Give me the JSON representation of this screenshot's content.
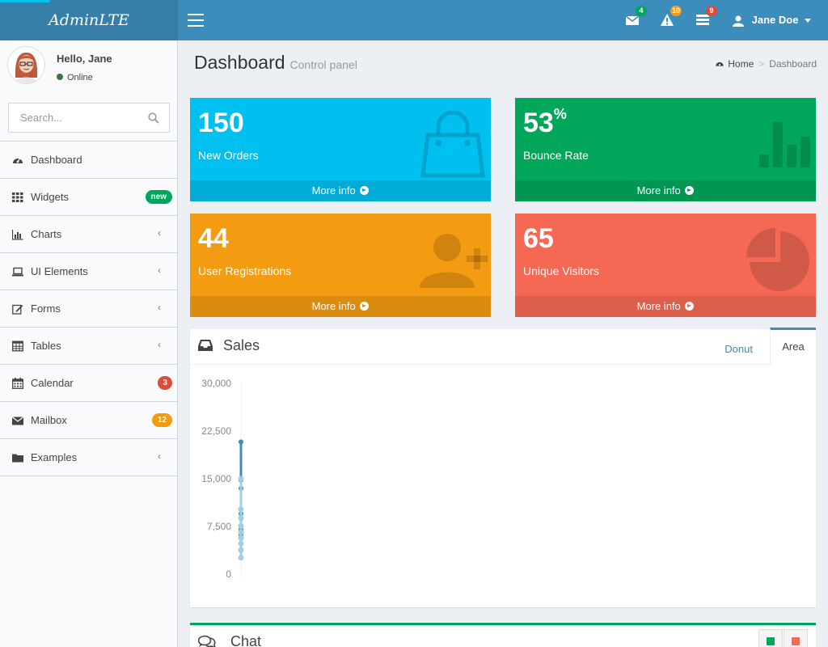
{
  "app": {
    "logo": "AdminLTE",
    "accent": "#3c8dbc"
  },
  "navbar": {
    "messages": {
      "icon": "envelope-icon",
      "count": "4",
      "color": "#00a65a"
    },
    "notifications": {
      "icon": "warning-icon",
      "count": "10",
      "color": "#f39c12"
    },
    "tasks": {
      "icon": "tasks-icon",
      "count": "9",
      "color": "#dd4b39"
    },
    "user": {
      "name": "Jane Doe",
      "icon": "user-icon"
    }
  },
  "sidebar": {
    "greeting": "Hello, Jane",
    "status": "Online",
    "search": {
      "placeholder": "Search...",
      "value": ""
    },
    "items": [
      {
        "label": "Dashboard",
        "icon": "dashboard-icon"
      },
      {
        "label": "Widgets",
        "icon": "th-icon",
        "badge": "new",
        "badge_color": "#00a65a"
      },
      {
        "label": "Charts",
        "icon": "bar-chart-icon",
        "chevron": "‹"
      },
      {
        "label": "UI Elements",
        "icon": "laptop-icon",
        "chevron": "‹"
      },
      {
        "label": "Forms",
        "icon": "edit-icon",
        "chevron": "‹"
      },
      {
        "label": "Tables",
        "icon": "table-icon",
        "chevron": "‹"
      },
      {
        "label": "Calendar",
        "icon": "calendar-icon",
        "badge": "3",
        "badge_color": "#dd4b39"
      },
      {
        "label": "Mailbox",
        "icon": "envelope-icon",
        "badge": "12",
        "badge_color": "#f39c12"
      },
      {
        "label": "Examples",
        "icon": "folder-icon",
        "chevron": "‹"
      }
    ]
  },
  "header": {
    "title": "Dashboard",
    "subtitle": "Control panel",
    "breadcrumb": {
      "home": "Home",
      "separator": ">",
      "current": "Dashboard"
    }
  },
  "boxes": [
    {
      "value": "150",
      "suffix": "",
      "label": "New Orders",
      "footer": "More info",
      "icon": "shopping-bag-icon",
      "color": "#00c0ef"
    },
    {
      "value": "53",
      "suffix": "%",
      "label": "Bounce Rate",
      "footer": "More info",
      "icon": "bar-chart-icon",
      "color": "#00a65a"
    },
    {
      "value": "44",
      "suffix": "",
      "label": "User Registrations",
      "footer": "More info",
      "icon": "user-plus-icon",
      "color": "#f39c12"
    },
    {
      "value": "65",
      "suffix": "",
      "label": "Unique Visitors",
      "footer": "More info",
      "icon": "pie-chart-icon",
      "color": "#f56954"
    }
  ],
  "sales": {
    "title": "Sales",
    "tabs": {
      "donut": "Donut",
      "area": "Area"
    }
  },
  "chat": {
    "title": "Chat"
  },
  "chart_data": {
    "type": "area",
    "ylim": [
      0,
      30000
    ],
    "yticks": [
      "30,000",
      "22,500",
      "15,000",
      "7,500",
      "0"
    ],
    "ytick_values": [
      30000,
      22500,
      15000,
      7500,
      0
    ],
    "series": [
      {
        "color": "#3c8dbc",
        "values": [
          20800,
          14800,
          13500,
          9500,
          7000,
          6200
        ]
      },
      {
        "color": "#a0d0e0",
        "values": [
          15000,
          10200,
          8800,
          7600,
          6600,
          5700,
          4800,
          3800,
          2600
        ]
      }
    ]
  }
}
